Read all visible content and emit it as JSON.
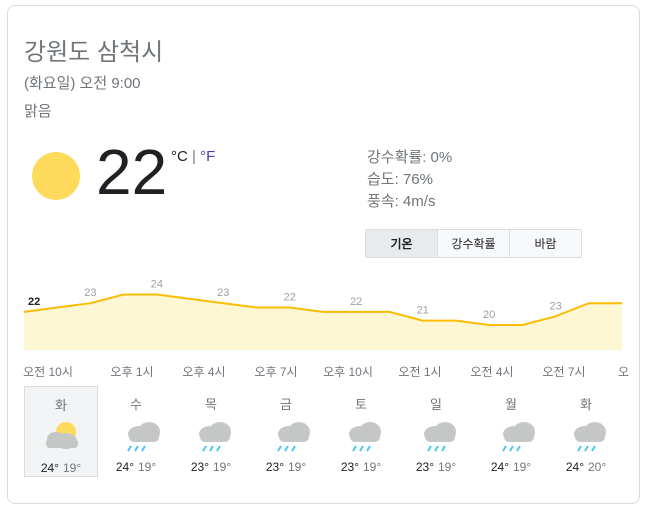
{
  "location": "강원도 삼척시",
  "datetime": "(화요일) 오전 9:00",
  "condition": "맑음",
  "current": {
    "temp": "22",
    "unit_c": "°C",
    "unit_sep": " | ",
    "unit_f": "°F",
    "precip": "강수확률: 0%",
    "humidity": "습도: 76%",
    "wind": "풍속: 4m/s",
    "icon": "sun-icon"
  },
  "tabs": [
    "기온",
    "강수확률",
    "바람"
  ],
  "colors": {
    "sun": "#fdd95c",
    "chart_line": "#fbbc04",
    "chart_fill": "#fef7d4",
    "rain": "#4fc3f7",
    "cloud": "#bdbdbd"
  },
  "chart_data": {
    "type": "area",
    "x": [
      "오전 10시",
      "오후 1시",
      "오후 4시",
      "오후 7시",
      "오후 10시",
      "오전 1시",
      "오전 4시",
      "오전 7시",
      "오"
    ],
    "series": [
      {
        "values": [
          22,
          22.5,
          23,
          24,
          24,
          23.5,
          23,
          22.5,
          22.5,
          22,
          22,
          22,
          21,
          21,
          20.5,
          20.5,
          21.5,
          23,
          23
        ]
      }
    ],
    "labels": [
      {
        "idx": 0,
        "value": "22"
      },
      {
        "idx": 2,
        "value": "23"
      },
      {
        "idx": 4,
        "value": "24"
      },
      {
        "idx": 6,
        "value": "23"
      },
      {
        "idx": 8,
        "value": "22"
      },
      {
        "idx": 10,
        "value": "22"
      },
      {
        "idx": 12,
        "value": "21"
      },
      {
        "idx": 14,
        "value": "20"
      },
      {
        "idx": 16,
        "value": "23"
      }
    ],
    "ylim": [
      19,
      25
    ]
  },
  "days": [
    {
      "name": "화",
      "hi": "24°",
      "lo": "19°",
      "icon": "partly-cloudy-icon",
      "selected": true
    },
    {
      "name": "수",
      "hi": "24°",
      "lo": "19°",
      "icon": "rain-showers-icon"
    },
    {
      "name": "목",
      "hi": "23°",
      "lo": "19°",
      "icon": "rain-icon"
    },
    {
      "name": "금",
      "hi": "23°",
      "lo": "19°",
      "icon": "rain-showers-icon"
    },
    {
      "name": "토",
      "hi": "23°",
      "lo": "19°",
      "icon": "rain-icon"
    },
    {
      "name": "일",
      "hi": "23°",
      "lo": "19°",
      "icon": "rain-icon"
    },
    {
      "name": "월",
      "hi": "24°",
      "lo": "19°",
      "icon": "rain-showers-icon"
    },
    {
      "name": "화",
      "hi": "24°",
      "lo": "20°",
      "icon": "rain-icon"
    }
  ]
}
